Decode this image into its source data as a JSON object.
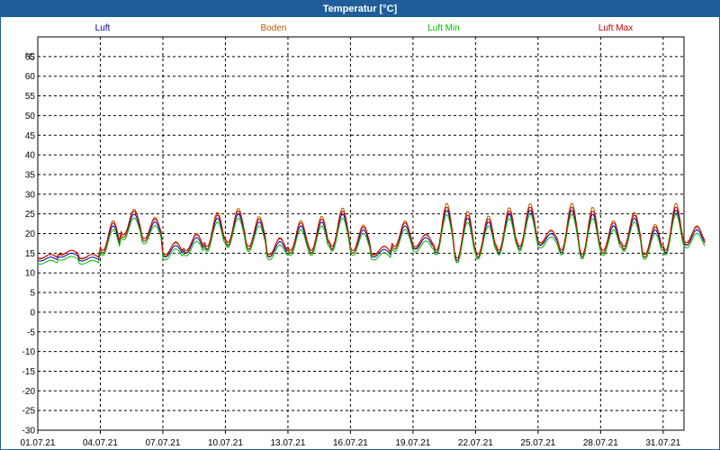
{
  "window": {
    "title": "Temperatur [°C]"
  },
  "chart_data": {
    "type": "line",
    "title": "Temperatur [°C]",
    "ylabel": "°C",
    "xlabel": "",
    "ylim": [
      -30,
      70
    ],
    "ytick_step": 5,
    "y_ticks": [
      "65",
      "60",
      "55",
      "50",
      "45",
      "40",
      "35",
      "30",
      "25",
      "20",
      "15",
      "10",
      "5",
      "0",
      "-5",
      "-10",
      "-15",
      "-20",
      "-25",
      "-30"
    ],
    "xlim": [
      "2021-07-01",
      "2021-08-01"
    ],
    "x_tick_labels": [
      "01.07.21",
      "04.07.21",
      "07.07.21",
      "10.07.21",
      "13.07.21",
      "16.07.21",
      "19.07.21",
      "22.07.21",
      "25.07.21",
      "28.07.21",
      "31.07.21"
    ],
    "grid": true,
    "legend": "top",
    "daily_max_air": [
      14,
      15,
      14,
      22,
      25,
      23,
      17,
      19,
      24,
      25,
      23,
      18,
      22,
      23,
      25,
      21,
      16,
      22,
      19,
      26,
      24,
      23,
      25,
      26,
      20,
      26,
      25,
      22,
      24,
      21,
      26,
      21
    ],
    "daily_min_air": [
      13,
      14,
      13,
      15,
      19,
      18,
      14,
      15,
      16,
      17,
      16,
      14,
      15,
      15,
      16,
      15,
      14,
      16,
      16,
      15,
      13,
      14,
      15,
      16,
      17,
      15,
      14,
      15,
      16,
      14,
      15,
      17
    ],
    "series": [
      {
        "name": "Luft",
        "color": "#0000aa",
        "offset": 0,
        "amp": 1.0
      },
      {
        "name": "Boden",
        "color": "#b35900",
        "offset": 0.6,
        "amp": 1.22
      },
      {
        "name": "Luft Min",
        "color": "#00bb00",
        "offset": -0.8,
        "amp": 0.95
      },
      {
        "name": "Luft Max",
        "color": "#cc0000",
        "offset": 0.7,
        "amp": 1.02
      }
    ]
  }
}
